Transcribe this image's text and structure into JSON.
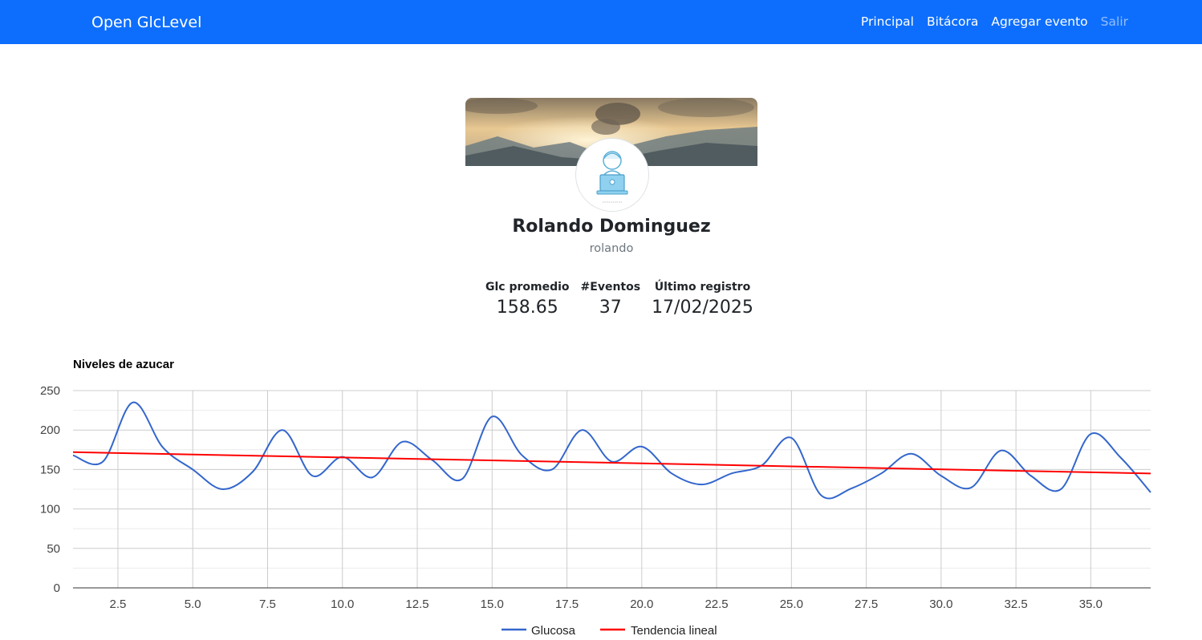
{
  "navbar": {
    "brand": "Open GlcLevel",
    "links": [
      "Principal",
      "Bitácora",
      "Agregar evento",
      "Salir"
    ]
  },
  "profile": {
    "name": "Rolando Dominguez",
    "username": "rolando"
  },
  "stats": [
    {
      "label": "Glc promedio",
      "value": "158.65"
    },
    {
      "label": "#Eventos",
      "value": "37"
    },
    {
      "label": "Último registro",
      "value": "17/02/2025"
    }
  ],
  "colors": {
    "navbar": "#0d6efd",
    "glucose_line": "#3366cc",
    "trend_line": "#ff0000"
  },
  "chart_data": {
    "type": "line",
    "title": "Niveles de azucar",
    "xlim": [
      1,
      37
    ],
    "ylim": [
      0,
      250
    ],
    "x_ticks": [
      "2.5",
      "5.0",
      "7.5",
      "10.0",
      "12.5",
      "15.0",
      "17.5",
      "20.0",
      "22.5",
      "25.0",
      "27.5",
      "30.0",
      "32.5",
      "35.0"
    ],
    "y_ticks": [
      "0",
      "50",
      "100",
      "150",
      "200",
      "250"
    ],
    "grid": true,
    "legend_position": "bottom",
    "series": [
      {
        "name": "Glucosa",
        "x": [
          1,
          2,
          3,
          4,
          5,
          6,
          7,
          8,
          9,
          10,
          11,
          12,
          13,
          14,
          15,
          16,
          17,
          18,
          19,
          20,
          21,
          22,
          23,
          24,
          25,
          26,
          27,
          28,
          29,
          30,
          31,
          32,
          33,
          34,
          35,
          36,
          37
        ],
        "values": [
          168,
          160,
          235,
          178,
          150,
          125,
          147,
          200,
          142,
          166,
          140,
          185,
          162,
          138,
          217,
          168,
          150,
          200,
          160,
          179,
          145,
          131,
          145,
          155,
          190,
          117,
          126,
          145,
          170,
          142,
          127,
          174,
          142,
          125,
          195,
          165,
          121
        ]
      },
      {
        "name": "Tendencia lineal",
        "x": [
          1,
          37
        ],
        "values": [
          172,
          145
        ]
      }
    ]
  }
}
